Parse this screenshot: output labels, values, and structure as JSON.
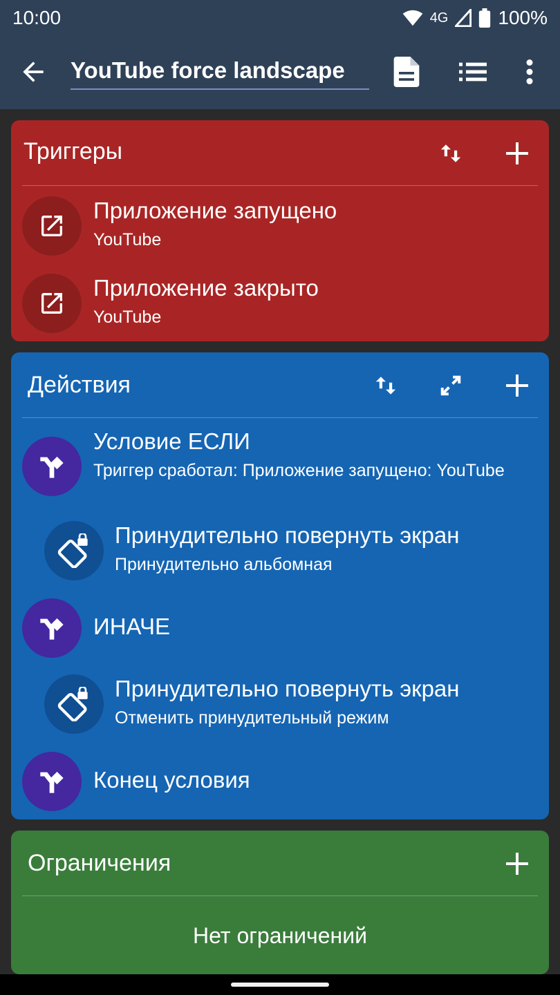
{
  "status_bar": {
    "time": "10:00",
    "network": "4G",
    "battery": "100%"
  },
  "app_bar": {
    "title": "YouTube force landscape",
    "icons": [
      "back-arrow-icon",
      "document-icon",
      "list-icon",
      "more-vert-icon"
    ]
  },
  "triggers": {
    "title": "Триггеры",
    "items": [
      {
        "title": "Приложение запущено",
        "subtitle": "YouTube",
        "icon": "open-in-new-icon"
      },
      {
        "title": "Приложение закрыто",
        "subtitle": "YouTube",
        "icon": "open-in-new-icon"
      }
    ]
  },
  "actions": {
    "title": "Действия",
    "items": [
      {
        "title": "Условие ЕСЛИ",
        "subtitle": "Триггер сработал: Приложение запущено: YouTube",
        "icon": "branch-icon"
      },
      {
        "title": "Принудительно повернуть экран",
        "subtitle": "Принудительно альбомная",
        "icon": "screen-rotation-lock-icon"
      },
      {
        "title": "ИНАЧЕ",
        "subtitle": "",
        "icon": "branch-icon"
      },
      {
        "title": "Принудительно повернуть экран",
        "subtitle": "Отменить принудительный режим",
        "icon": "screen-rotation-lock-icon"
      },
      {
        "title": "Конец условия",
        "subtitle": "",
        "icon": "branch-icon"
      }
    ]
  },
  "constraints": {
    "title": "Ограничения",
    "empty_text": "Нет ограничений"
  },
  "colors": {
    "app_bar": "#2f4157",
    "triggers_card": "#a92525",
    "actions_card": "#1565b3",
    "constraints_card": "#3a7d3b",
    "condition_circle": "#4527a0"
  }
}
